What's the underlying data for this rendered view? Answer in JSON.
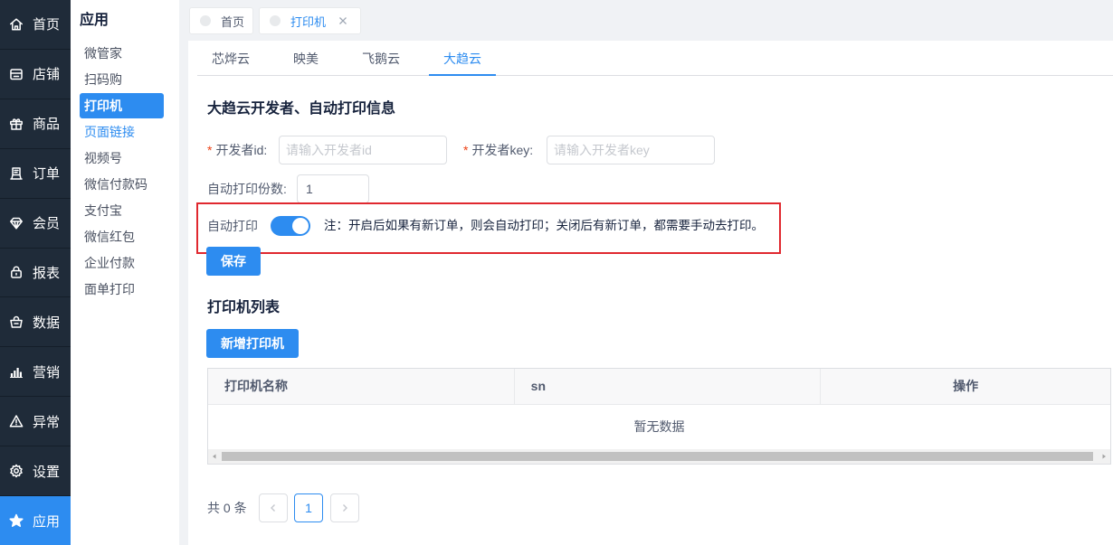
{
  "theme": {
    "primary": "#2d8cf0",
    "nav_bg": "#1f2b39",
    "annotation": "#e0282f",
    "required": "#ed4014"
  },
  "main_nav": {
    "items": [
      {
        "label": "首页",
        "icon": "home-icon",
        "active": false
      },
      {
        "label": "店铺",
        "icon": "store-icon",
        "active": false
      },
      {
        "label": "商品",
        "icon": "gift-icon",
        "active": false
      },
      {
        "label": "订单",
        "icon": "order-icon",
        "active": false
      },
      {
        "label": "会员",
        "icon": "diamond-icon",
        "active": false
      },
      {
        "label": "报表",
        "icon": "lock-icon",
        "active": false
      },
      {
        "label": "数据",
        "icon": "basket-icon",
        "active": false
      },
      {
        "label": "营销",
        "icon": "bar-chart-icon",
        "active": false
      },
      {
        "label": "异常",
        "icon": "warning-icon",
        "active": false
      },
      {
        "label": "设置",
        "icon": "gear-icon",
        "active": false
      },
      {
        "label": "应用",
        "icon": "star-icon",
        "active": true
      }
    ]
  },
  "sub_nav": {
    "title": "应用",
    "items": [
      {
        "label": "微管家",
        "active": false,
        "highlighted": false
      },
      {
        "label": "扫码购",
        "active": false,
        "highlighted": false
      },
      {
        "label": "打印机",
        "active": true,
        "highlighted": false
      },
      {
        "label": "页面链接",
        "active": false,
        "highlighted": true
      },
      {
        "label": "视频号",
        "active": false,
        "highlighted": false
      },
      {
        "label": "微信付款码",
        "active": false,
        "highlighted": false
      },
      {
        "label": "支付宝",
        "active": false,
        "highlighted": false
      },
      {
        "label": "微信红包",
        "active": false,
        "highlighted": false
      },
      {
        "label": "企业付款",
        "active": false,
        "highlighted": false
      },
      {
        "label": "面单打印",
        "active": false,
        "highlighted": false
      }
    ]
  },
  "page_tabs": [
    {
      "label": "首页",
      "active": false,
      "closable": false
    },
    {
      "label": "打印机",
      "active": true,
      "closable": true
    }
  ],
  "vendor_tabs": [
    {
      "label": "芯烨云",
      "active": false
    },
    {
      "label": "映美",
      "active": false
    },
    {
      "label": "飞鹅云",
      "active": false
    },
    {
      "label": "大趋云",
      "active": true
    }
  ],
  "settings_form": {
    "title": "大趋云开发者、自动打印信息",
    "required_mark": "*",
    "developer_id": {
      "label": "开发者id:",
      "placeholder": "请输入开发者id",
      "value": ""
    },
    "developer_key": {
      "label": "开发者key:",
      "placeholder": "请输入开发者key",
      "value": ""
    },
    "print_copies": {
      "label": "自动打印份数:",
      "value": "1"
    },
    "auto_print": {
      "label": "自动打印",
      "enabled": true,
      "note": "注：开启后如果有新订单，则会自动打印；关闭后有新订单，都需要手动去打印。"
    },
    "save_label": "保存"
  },
  "printer_list": {
    "title": "打印机列表",
    "add_label": "新增打印机",
    "columns": [
      "打印机名称",
      "sn",
      "操作"
    ],
    "rows": [],
    "empty_text": "暂无数据"
  },
  "pagination": {
    "total_text": "共 0 条",
    "current_page": "1"
  }
}
